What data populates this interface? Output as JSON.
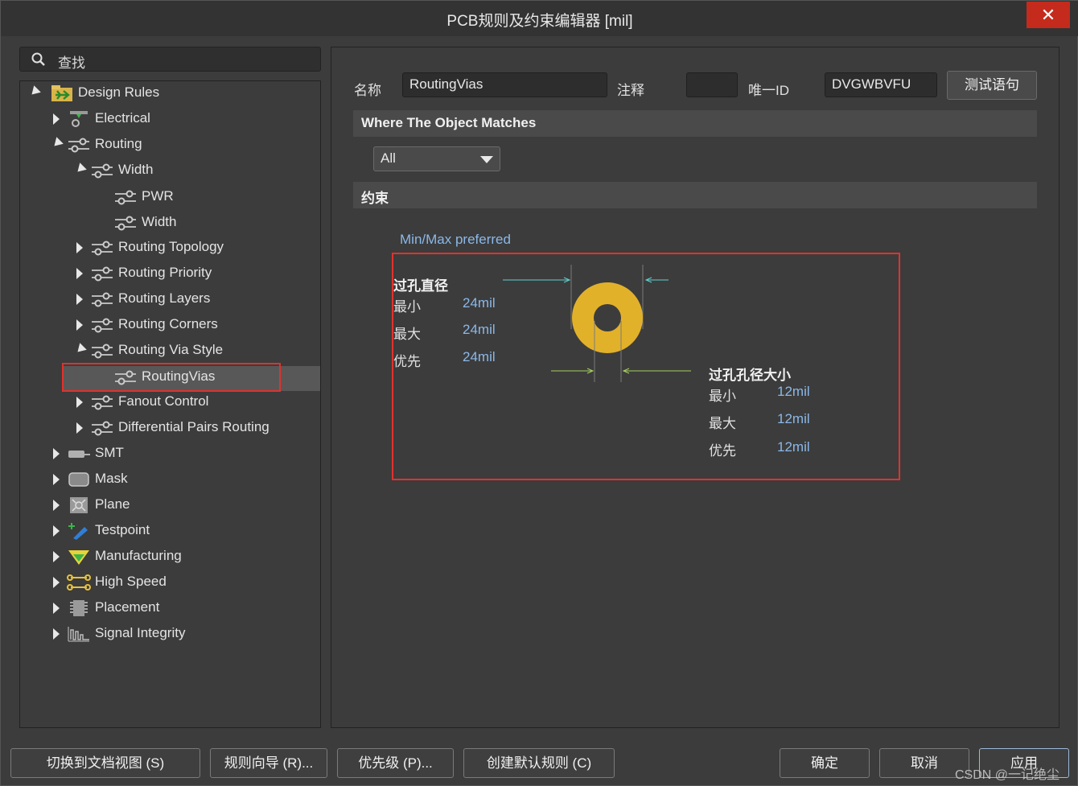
{
  "window": {
    "title": "PCB规则及约束编辑器 [mil]",
    "close_glyph": "✕"
  },
  "search": {
    "label": "查找"
  },
  "tree": {
    "root": "Design Rules",
    "electrical": "Electrical",
    "routing": "Routing",
    "width": "Width",
    "pwr": "PWR",
    "width_rule": "Width",
    "routing_topology": "Routing Topology",
    "routing_priority": "Routing Priority",
    "routing_layers": "Routing Layers",
    "routing_corners": "Routing Corners",
    "routing_via_style": "Routing Via Style",
    "routing_vias": "RoutingVias",
    "fanout_control": "Fanout Control",
    "diff_pairs": "Differential Pairs Routing",
    "smt": "SMT",
    "mask": "Mask",
    "plane": "Plane",
    "testpoint": "Testpoint",
    "manufacturing": "Manufacturing",
    "high_speed": "High Speed",
    "placement": "Placement",
    "signal_integrity": "Signal Integrity"
  },
  "form": {
    "name_label": "名称",
    "name_value": "RoutingVias",
    "comment_label": "注释",
    "comment_value": "",
    "uid_label": "唯一ID",
    "uid_value": "DVGWBVFU",
    "test_button": "测试语句",
    "where_header": "Where The Object Matches",
    "scope_value": "All",
    "constraints_header": "约束"
  },
  "constraints": {
    "mode": "Min/Max preferred",
    "via_diameter_title": "过孔直径",
    "via_min_label": "最小",
    "via_min_value": "24mil",
    "via_max_label": "最大",
    "via_max_value": "24mil",
    "via_pref_label": "优先",
    "via_pref_value": "24mil",
    "hole_title": "过孔孔径大小",
    "hole_min_label": "最小",
    "hole_min_value": "12mil",
    "hole_max_label": "最大",
    "hole_max_value": "12mil",
    "hole_pref_label": "优先",
    "hole_pref_value": "12mil",
    "pad_color": "#e2b12a"
  },
  "footer": {
    "switch_view": "切换到文档视图 (S)",
    "rule_wizard": "规则向导 (R)...",
    "priorities": "优先级 (P)...",
    "create_default": "创建默认规则 (C)",
    "ok": "确定",
    "cancel": "取消",
    "apply": "应用"
  },
  "watermark": "CSDN @一记绝尘"
}
